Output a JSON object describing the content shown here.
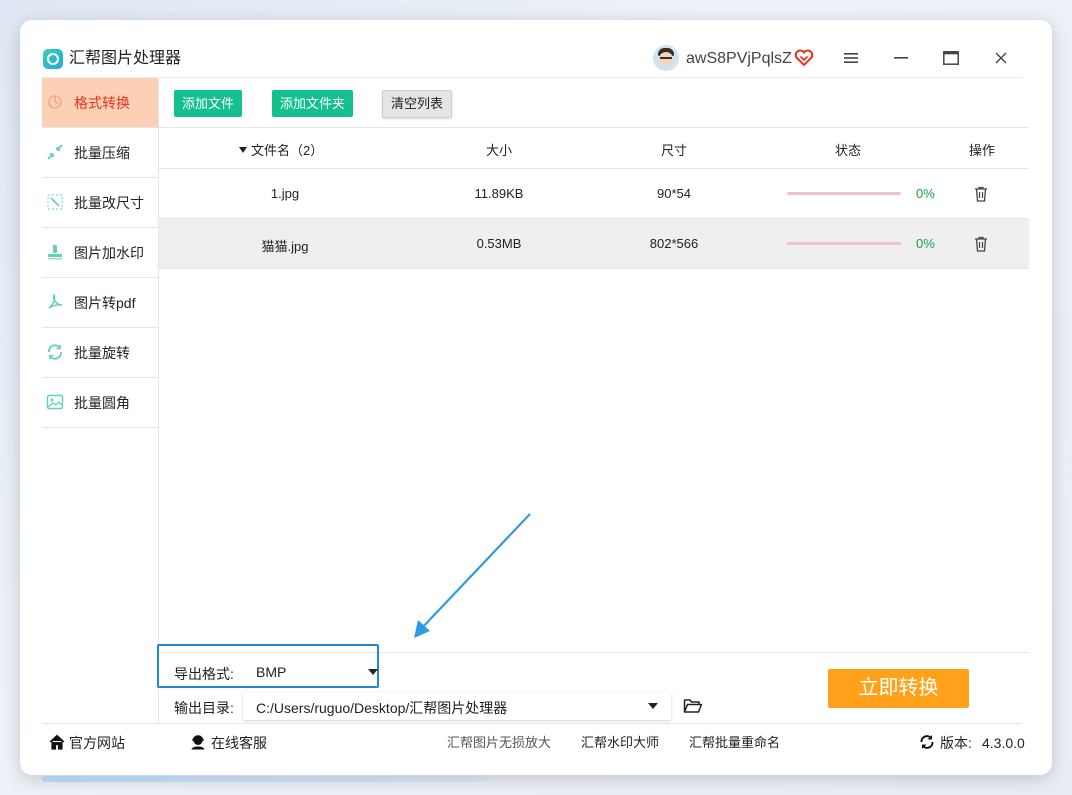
{
  "app": {
    "title": "汇帮图片处理器",
    "username": "awS8PVjPqlsZ"
  },
  "colors": {
    "accent_green": "#14c18e",
    "active_tab_bg": "#fcd0b4",
    "active_tab_text": "#e8321f",
    "convert_button": "#ffa21a",
    "highlight_border": "#1e88d6",
    "progress_track": "#f2c2cc",
    "progress_text": "#14a34a"
  },
  "sidebar": {
    "items": [
      {
        "label": "格式转换",
        "icon": "format-convert-icon",
        "active": true
      },
      {
        "label": "批量压缩",
        "icon": "compress-icon",
        "active": false
      },
      {
        "label": "批量改尺寸",
        "icon": "resize-icon",
        "active": false
      },
      {
        "label": "图片加水印",
        "icon": "watermark-icon",
        "active": false
      },
      {
        "label": "图片转pdf",
        "icon": "pdf-icon",
        "active": false
      },
      {
        "label": "批量旋转",
        "icon": "rotate-icon",
        "active": false
      },
      {
        "label": "批量圆角",
        "icon": "rounded-corner-icon",
        "active": false
      }
    ]
  },
  "toolbar": {
    "add_file": "添加文件",
    "add_folder": "添加文件夹",
    "clear_list": "清空列表"
  },
  "table": {
    "headers": {
      "filename": "文件名（2）",
      "size": "大小",
      "dimensions": "尺寸",
      "status": "状态",
      "actions": "操作"
    },
    "rows": [
      {
        "filename": "1.jpg",
        "size": "11.89KB",
        "dimensions": "90*54",
        "progress": 0,
        "percent": "0%"
      },
      {
        "filename": "猫猫.jpg",
        "size": "0.53MB",
        "dimensions": "802*566",
        "progress": 0,
        "percent": "0%"
      }
    ]
  },
  "output": {
    "format_label": "导出格式:",
    "format_value": "BMP",
    "dir_label": "输出目录:",
    "dir_value": "C:/Users/ruguo/Desktop/汇帮图片处理器",
    "convert_button": "立即转换"
  },
  "footer": {
    "official_site": "官方网站",
    "online_service": "在线客服",
    "link_1": "汇帮图片无损放大",
    "link_2": "汇帮水印大师",
    "link_3": "汇帮批量重命名",
    "version_label": "版本:",
    "version_value": "4.3.0.0"
  }
}
